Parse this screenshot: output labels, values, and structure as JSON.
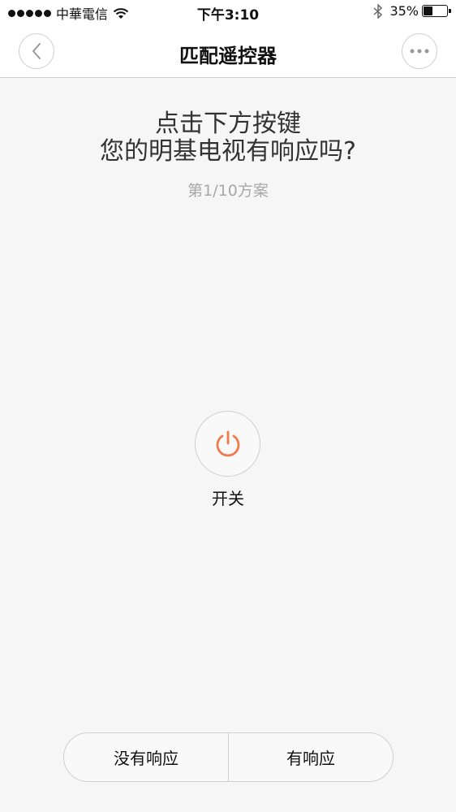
{
  "status_bar": {
    "carrier": "中華電信",
    "time": "下午3:10",
    "battery": "35%",
    "battery_level": 0.35,
    "icons": [
      "signal-dots",
      "wifi-icon",
      "bluetooth-icon",
      "battery-icon"
    ]
  },
  "nav": {
    "title": "匹配遥控器",
    "back_icon": "chevron-left-icon",
    "more_icon": "more-dots-icon"
  },
  "prompt": {
    "line1": "点击下方按键",
    "line2": "您的明基电视有响应吗?",
    "scheme": "第1/10方案"
  },
  "test_key": {
    "icon": "power-icon",
    "label": "开关",
    "accent_color": "#f07a4a"
  },
  "answers": {
    "no": "没有响应",
    "yes": "有响应"
  }
}
